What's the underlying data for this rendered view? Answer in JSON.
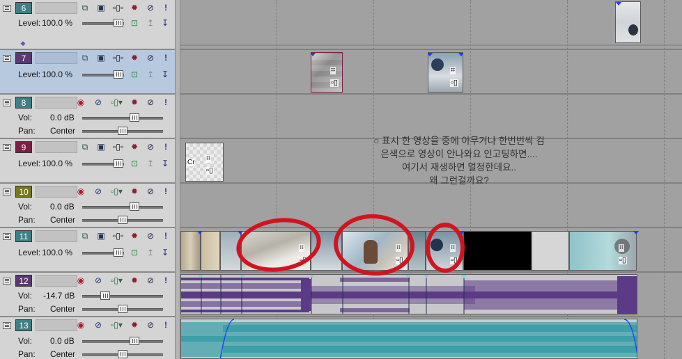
{
  "tracks": [
    {
      "number": "6",
      "color": "#3f7f84",
      "type": "video",
      "row1_label": "Level:",
      "row1_value": "100.0 %"
    },
    {
      "number": "7",
      "color": "#5a3872",
      "type": "video",
      "row1_label": "Level:",
      "row1_value": "100.0 %",
      "selected": true
    },
    {
      "number": "8",
      "color": "#3f7f84",
      "type": "audio",
      "row1_label": "Vol:",
      "row1_value": "0.0 dB",
      "row2_label": "Pan:",
      "row2_value": "Center"
    },
    {
      "number": "9",
      "color": "#7a1f45",
      "type": "video",
      "row1_label": "Level:",
      "row1_value": "100.0 %"
    },
    {
      "number": "10",
      "color": "#777722",
      "type": "audio",
      "row1_label": "Vol:",
      "row1_value": "0.0 dB",
      "row2_label": "Pan:",
      "row2_value": "Center"
    },
    {
      "number": "11",
      "color": "#3f7f84",
      "type": "video",
      "row1_label": "Level:",
      "row1_value": "100.0 %"
    },
    {
      "number": "12",
      "color": "#5a3872",
      "type": "audio",
      "row1_label": "Vol:",
      "row1_value": "-14.7 dB",
      "row2_label": "Pan:",
      "row2_value": "Center"
    },
    {
      "number": "13",
      "color": "#3f7f84",
      "type": "audio",
      "row1_label": "Vol:",
      "row1_value": "0.0 dB",
      "row2_label": "Pan:",
      "row2_value": "Center"
    }
  ],
  "icons": {
    "video": [
      "composite-mode-icon",
      "track-motion-icon",
      "fx-chain-icon",
      "settings-gear-icon",
      "mute-icon",
      "solo-icon"
    ],
    "audio": [
      "record-arm-icon",
      "invert-phase-icon",
      "fx-chain-icon",
      "settings-gear-icon",
      "mute-icon",
      "solo-icon"
    ]
  },
  "clip_labels": {
    "track9_clip": "Cr"
  },
  "question": {
    "line1": "○ 표시 한 영상을 중에 아무거나 한번번씩 검",
    "line2": "은색으로 영상이 안나와요 인고팅하면....",
    "line3": "여기서 재생하면 멀정한데요..",
    "line4": "왜 그런걸까요?"
  },
  "colors": {
    "annotation_red": "#d11420",
    "selection": "#b7c9df",
    "audio_wave_purple": "#5b3b85",
    "audio_wave_teal": "#3d9fa8"
  }
}
